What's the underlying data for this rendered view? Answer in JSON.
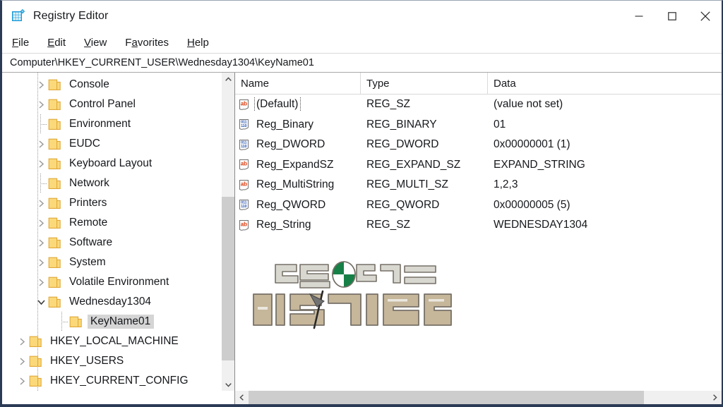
{
  "window": {
    "title": "Registry Editor",
    "icon": "registry-editor-icon",
    "controls": {
      "minimize": "─",
      "maximize": "□",
      "close": "✕"
    }
  },
  "menubar": {
    "items": [
      {
        "accel": "F",
        "rest": "ile"
      },
      {
        "accel": "E",
        "rest": "dit"
      },
      {
        "accel": "V",
        "rest": "iew"
      },
      {
        "pre": "F",
        "accel": "a",
        "rest": "vorites"
      },
      {
        "accel": "H",
        "rest": "elp"
      }
    ],
    "labels": [
      "File",
      "Edit",
      "View",
      "Favorites",
      "Help"
    ]
  },
  "addressbar": {
    "path": "Computer\\HKEY_CURRENT_USER\\Wednesday1304\\KeyName01"
  },
  "tree": {
    "items": [
      {
        "label": "Console",
        "indent": 1,
        "state": "collapsed",
        "selected": false
      },
      {
        "label": "Control Panel",
        "indent": 1,
        "state": "collapsed",
        "selected": false
      },
      {
        "label": "Environment",
        "indent": 1,
        "state": "leaf",
        "selected": false
      },
      {
        "label": "EUDC",
        "indent": 1,
        "state": "collapsed",
        "selected": false
      },
      {
        "label": "Keyboard Layout",
        "indent": 1,
        "state": "collapsed",
        "selected": false
      },
      {
        "label": "Network",
        "indent": 1,
        "state": "leaf",
        "selected": false
      },
      {
        "label": "Printers",
        "indent": 1,
        "state": "collapsed",
        "selected": false
      },
      {
        "label": "Remote",
        "indent": 1,
        "state": "collapsed",
        "selected": false
      },
      {
        "label": "Software",
        "indent": 1,
        "state": "collapsed",
        "selected": false
      },
      {
        "label": "System",
        "indent": 1,
        "state": "collapsed",
        "selected": false
      },
      {
        "label": "Volatile Environment",
        "indent": 1,
        "state": "collapsed",
        "selected": false
      },
      {
        "label": "Wednesday1304",
        "indent": 1,
        "state": "expanded",
        "selected": false
      },
      {
        "label": "KeyName01",
        "indent": 2,
        "state": "leaf",
        "selected": true
      },
      {
        "label": "HKEY_LOCAL_MACHINE",
        "indent": 0,
        "state": "collapsed",
        "selected": false
      },
      {
        "label": "HKEY_USERS",
        "indent": 0,
        "state": "collapsed",
        "selected": false
      },
      {
        "label": "HKEY_CURRENT_CONFIG",
        "indent": 0,
        "state": "collapsed",
        "selected": false
      }
    ]
  },
  "list": {
    "columns": [
      "Name",
      "Type",
      "Data"
    ],
    "rows": [
      {
        "icon": "string-value-icon",
        "name": "(Default)",
        "type": "REG_SZ",
        "data": "(value not set)",
        "focused": true
      },
      {
        "icon": "binary-value-icon",
        "name": "Reg_Binary",
        "type": "REG_BINARY",
        "data": "01",
        "focused": false
      },
      {
        "icon": "binary-value-icon",
        "name": "Reg_DWORD",
        "type": "REG_DWORD",
        "data": "0x00000001 (1)",
        "focused": false
      },
      {
        "icon": "string-value-icon",
        "name": "Reg_ExpandSZ",
        "type": "REG_EXPAND_SZ",
        "data": "EXPAND_STRING",
        "focused": false
      },
      {
        "icon": "string-value-icon",
        "name": "Reg_MultiString",
        "type": "REG_MULTI_SZ",
        "data": "1,2,3",
        "focused": false
      },
      {
        "icon": "binary-value-icon",
        "name": "Reg_QWORD",
        "type": "REG_QWORD",
        "data": "0x00000005 (5)",
        "focused": false
      },
      {
        "icon": "string-value-icon",
        "name": "Reg_String",
        "type": "REG_SZ",
        "data": "WEDNESDAY1304",
        "focused": false
      }
    ]
  },
  "watermark": {
    "line1": "만들어가는",
    "line2": "아스가르드"
  },
  "scrollbars": {
    "tree_vertical": {
      "up": "˄",
      "down": "˅",
      "thumb_top_pct": 38,
      "thumb_height_pct": 56
    },
    "list_horizontal": {
      "left": "‹",
      "right": "›",
      "thumb_left_pct": 0,
      "thumb_width_pct": 86
    }
  },
  "colors": {
    "folder": "#fbd97a",
    "folder_edge": "#e0a93a",
    "string_icon": "#d93a0b",
    "binary_icon": "#1f4fb0",
    "selection": "#d5d5d5",
    "window_border": "#2b3a55",
    "scrollbar_thumb": "#cdcdcd"
  }
}
